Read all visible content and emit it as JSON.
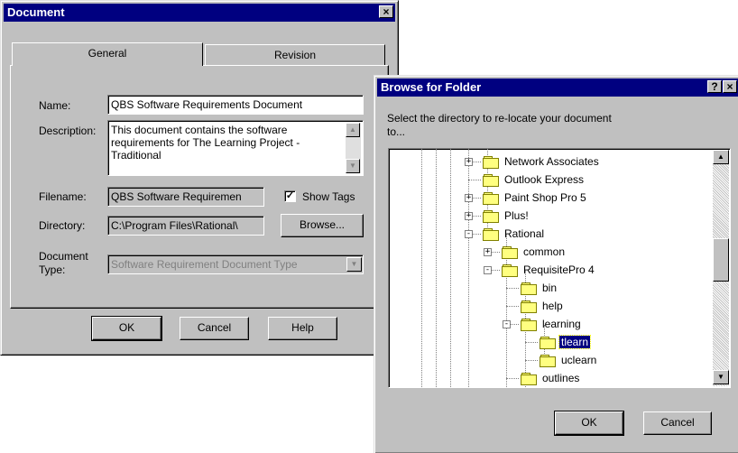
{
  "document_dialog": {
    "title": "Document",
    "close_glyph": "×",
    "tabs": {
      "general": "General",
      "revision": "Revision"
    },
    "name_label": "Name:",
    "name_value": "QBS Software Requirements Document",
    "description_label": "Description:",
    "description_lines": [
      "This document contains the software",
      "requirements for The Learning Project -",
      "Traditional"
    ],
    "filename_label": "Filename:",
    "filename_value": "QBS Software Requiremen",
    "show_tags_label": "Show Tags",
    "show_tags_checked": true,
    "directory_label": "Directory:",
    "directory_value": "C:\\Program Files\\Rational\\",
    "browse_label": "Browse...",
    "doc_type_label_1": "Document",
    "doc_type_label_2": "Type:",
    "doc_type_value": "Software Requirement Document Type",
    "ok_label": "OK",
    "cancel_label": "Cancel",
    "help_label": "Help"
  },
  "browse_dialog": {
    "title": "Browse for Folder",
    "help_glyph": "?",
    "close_glyph": "×",
    "prompt_1": "Select the directory to re-locate your document",
    "prompt_2": "to...",
    "tree": [
      {
        "label": "Network Associates",
        "expander": "+"
      },
      {
        "label": "Outlook Express",
        "expander": ""
      },
      {
        "label": "Paint Shop Pro 5",
        "expander": "+"
      },
      {
        "label": "Plus!",
        "expander": "+"
      },
      {
        "label": "Rational",
        "expander": "-"
      },
      {
        "label": "common",
        "expander": "+"
      },
      {
        "label": "RequisitePro 4",
        "expander": "-"
      },
      {
        "label": "bin",
        "expander": ""
      },
      {
        "label": "help",
        "expander": ""
      },
      {
        "label": "learning",
        "expander": "-"
      },
      {
        "label": "tlearn",
        "expander": "",
        "selected": true
      },
      {
        "label": "uclearn",
        "expander": ""
      },
      {
        "label": "outlines",
        "expander": ""
      }
    ],
    "ok_label": "OK",
    "cancel_label": "Cancel"
  }
}
